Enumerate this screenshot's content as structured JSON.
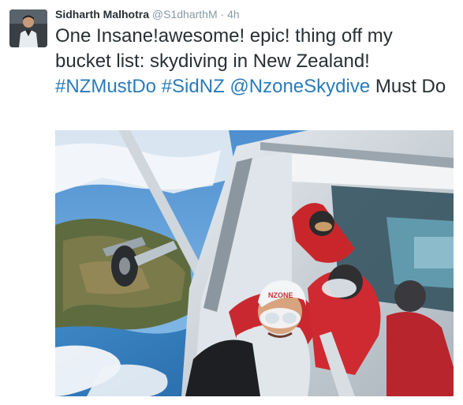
{
  "tweet": {
    "author_name": "Sidharth Malhotra",
    "author_handle": "@S1dharthM",
    "separator": "·",
    "timestamp": "4h",
    "text_plain_1": "One Insane!awesome! epic! thing off my bucket list: skydiving in New Zealand! ",
    "hashtag_1": "#NZMustDo",
    "hashtag_2": "#SidNZ",
    "mention_1": "@NzoneSkydive",
    "text_plain_2": " Must Do",
    "helmet_text": "NZONE"
  },
  "colors": {
    "name": "#292f33",
    "meta": "#8899a6",
    "link": "#2b7bb9",
    "text": "#292f33"
  }
}
